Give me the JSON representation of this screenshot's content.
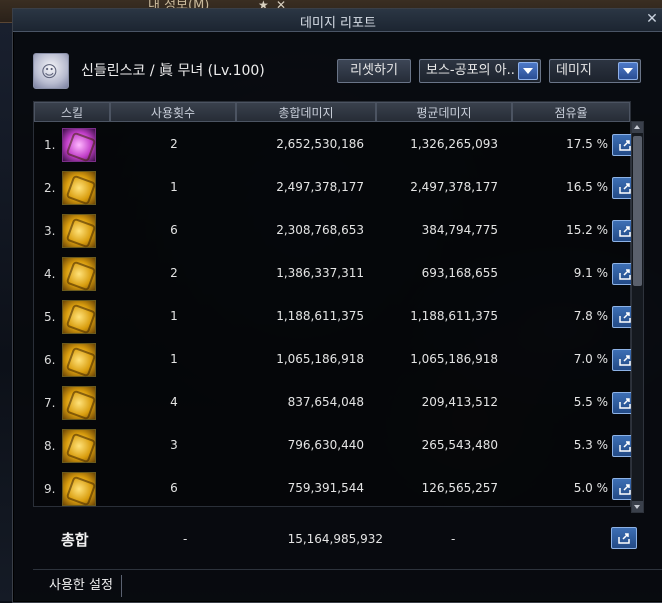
{
  "window": {
    "title": "데미지 리포트"
  },
  "background": {
    "top_text": "내 정보(M)"
  },
  "character": {
    "name": "신들린스코 / 眞 무녀 (Lv.100)"
  },
  "controls": {
    "reset_label": "리셋하기",
    "dungeon_select": "보스-공포의 아..",
    "metric_select": "데미지"
  },
  "table": {
    "headers": [
      "스킬",
      "사용횟수",
      "총합데미지",
      "평균데미지",
      "점유율"
    ],
    "rows": [
      {
        "rank": "1.",
        "icon": "skill-icon-purple",
        "count": "2",
        "total": "2,652,530,186",
        "avg": "1,326,265,093",
        "share": "17.5 %"
      },
      {
        "rank": "2.",
        "icon": "skill-icon-gold",
        "count": "1",
        "total": "2,497,378,177",
        "avg": "2,497,378,177",
        "share": "16.5 %"
      },
      {
        "rank": "3.",
        "icon": "skill-icon-gold",
        "count": "6",
        "total": "2,308,768,653",
        "avg": "384,794,775",
        "share": "15.2 %"
      },
      {
        "rank": "4.",
        "icon": "skill-icon-gold",
        "count": "2",
        "total": "1,386,337,311",
        "avg": "693,168,655",
        "share": "9.1 %"
      },
      {
        "rank": "5.",
        "icon": "skill-icon-gold",
        "count": "1",
        "total": "1,188,611,375",
        "avg": "1,188,611,375",
        "share": "7.8 %"
      },
      {
        "rank": "6.",
        "icon": "skill-icon-gold",
        "count": "1",
        "total": "1,065,186,918",
        "avg": "1,065,186,918",
        "share": "7.0 %"
      },
      {
        "rank": "7.",
        "icon": "skill-icon-gold",
        "count": "4",
        "total": "837,654,048",
        "avg": "209,413,512",
        "share": "5.5 %"
      },
      {
        "rank": "8.",
        "icon": "skill-icon-gold",
        "count": "3",
        "total": "796,630,440",
        "avg": "265,543,480",
        "share": "5.3 %"
      },
      {
        "rank": "9.",
        "icon": "skill-icon-gold",
        "count": "6",
        "total": "759,391,544",
        "avg": "126,565,257",
        "share": "5.0 %"
      }
    ]
  },
  "summary": {
    "label": "총합",
    "count": "-",
    "total": "15,164,985,932",
    "avg": "-"
  },
  "tabs": {
    "used_settings": "사용한 설정"
  },
  "colors": {
    "accent_blue": "#3d6fb4",
    "skill_gold": "#d99d0e",
    "skill_purple": "#c23fc9"
  }
}
